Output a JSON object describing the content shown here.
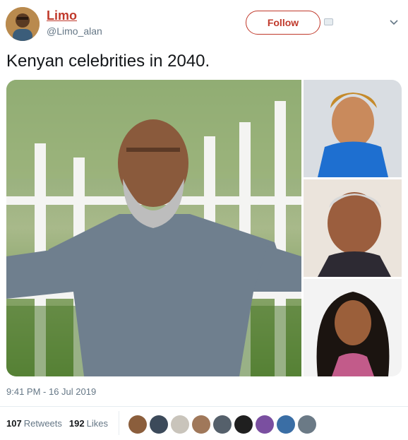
{
  "user": {
    "display_name": "Limo",
    "handle": "@Limo_alan",
    "avatar_icon": "user-avatar"
  },
  "header": {
    "follow_label": "Follow",
    "card_icon": "card-icon",
    "menu_icon": "chevron-down-icon"
  },
  "tweet": {
    "text": "Kenyan celebrities in 2040.",
    "timestamp": "9:41 PM - 16 Jul 2019"
  },
  "media": {
    "photos": [
      "main-photo",
      "photo-woman-blue",
      "photo-older-man",
      "photo-woman-curly-hair"
    ]
  },
  "stats": {
    "retweets_count": "107",
    "retweets_label": "Retweets",
    "likes_count": "192",
    "likes_label": "Likes"
  },
  "likers": [
    "liker-1",
    "liker-2",
    "liker-3",
    "liker-4",
    "liker-5",
    "liker-6",
    "liker-7",
    "liker-8",
    "liker-9"
  ],
  "colors": {
    "accent": "#c0392b",
    "muted": "#657786",
    "text": "#14171a",
    "divider": "#e6ecf0"
  }
}
